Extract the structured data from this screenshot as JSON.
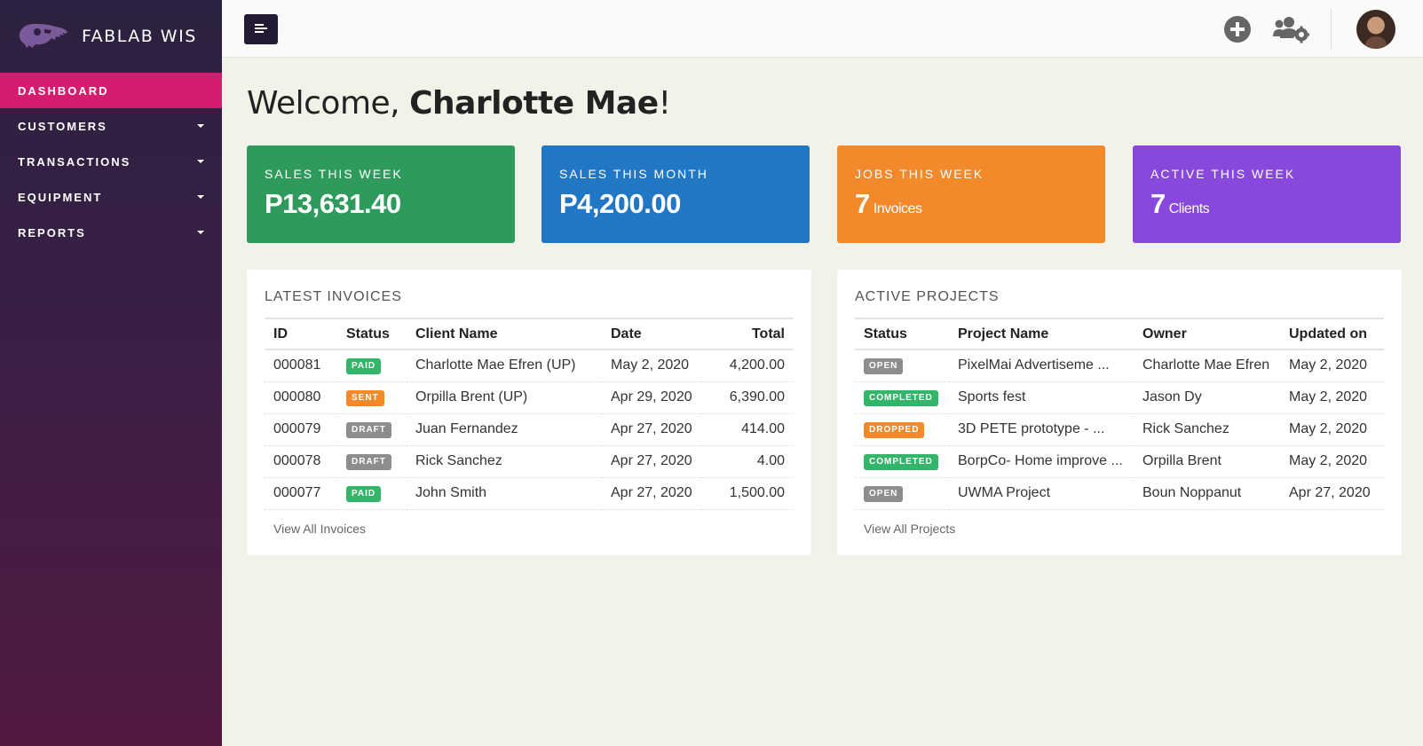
{
  "brand": {
    "name": "FABLAB WIS"
  },
  "sidebar": {
    "items": [
      {
        "label": "DASHBOARD",
        "active": true,
        "has_caret": false
      },
      {
        "label": "CUSTOMERS",
        "active": false,
        "has_caret": true
      },
      {
        "label": "TRANSACTIONS",
        "active": false,
        "has_caret": true
      },
      {
        "label": "EQUIPMENT",
        "active": false,
        "has_caret": true
      },
      {
        "label": "REPORTS",
        "active": false,
        "has_caret": true
      }
    ]
  },
  "topbar": {
    "icons": [
      "menu-icon",
      "add-circle-icon",
      "users-settings-icon",
      "avatar"
    ]
  },
  "welcome": {
    "prefix": "Welcome, ",
    "name": "Charlotte Mae",
    "suffix": "!"
  },
  "stats": [
    {
      "label": "SALES THIS WEEK",
      "value": "P13,631.40",
      "color": "#2e9b5d"
    },
    {
      "label": "SALES THIS MONTH",
      "value": "P4,200.00",
      "color": "#2277c4"
    },
    {
      "label": "JOBS THIS WEEK",
      "count": "7",
      "unit": "Invoices",
      "color": "#f28a2c"
    },
    {
      "label": "ACTIVE THIS WEEK",
      "count": "7",
      "unit": "Clients",
      "color": "#8848dc"
    }
  ],
  "invoices": {
    "title": "LATEST INVOICES",
    "columns": [
      "ID",
      "Status",
      "Client Name",
      "Date",
      "Total"
    ],
    "rows": [
      {
        "id": "000081",
        "status": "PAID",
        "client": "Charlotte Mae Efren (UP)",
        "date": "May 2, 2020",
        "total": "4,200.00"
      },
      {
        "id": "000080",
        "status": "SENT",
        "client": "Orpilla Brent (UP)",
        "date": "Apr 29, 2020",
        "total": "6,390.00"
      },
      {
        "id": "000079",
        "status": "DRAFT",
        "client": "Juan Fernandez",
        "date": "Apr 27, 2020",
        "total": "414.00"
      },
      {
        "id": "000078",
        "status": "DRAFT",
        "client": "Rick Sanchez",
        "date": "Apr 27, 2020",
        "total": "4.00"
      },
      {
        "id": "000077",
        "status": "PAID",
        "client": "John Smith",
        "date": "Apr 27, 2020",
        "total": "1,500.00"
      }
    ],
    "view_all": "View All Invoices"
  },
  "projects": {
    "title": "ACTIVE PROJECTS",
    "columns": [
      "Status",
      "Project Name",
      "Owner",
      "Updated on"
    ],
    "rows": [
      {
        "status": "OPEN",
        "name": "PixelMai Advertiseme ...",
        "owner": "Charlotte Mae Efren",
        "updated": "May 2, 2020"
      },
      {
        "status": "COMPLETED",
        "name": "Sports fest",
        "owner": "Jason Dy",
        "updated": "May 2, 2020"
      },
      {
        "status": "DROPPED",
        "name": "3D PETE prototype - ...",
        "owner": "Rick Sanchez",
        "updated": "May 2, 2020"
      },
      {
        "status": "COMPLETED",
        "name": "BorpCo- Home improve ...",
        "owner": "Orpilla Brent",
        "updated": "May 2, 2020"
      },
      {
        "status": "OPEN",
        "name": "UWMA Project",
        "owner": "Boun Noppanut",
        "updated": "Apr 27, 2020"
      }
    ],
    "view_all": "View All Projects"
  },
  "badge_colors": {
    "PAID": "#33b66a",
    "SENT": "#f28a2c",
    "DRAFT": "#8d8d8d",
    "OPEN": "#8d8d8d",
    "COMPLETED": "#33b66a",
    "DROPPED": "#f28a2c"
  }
}
